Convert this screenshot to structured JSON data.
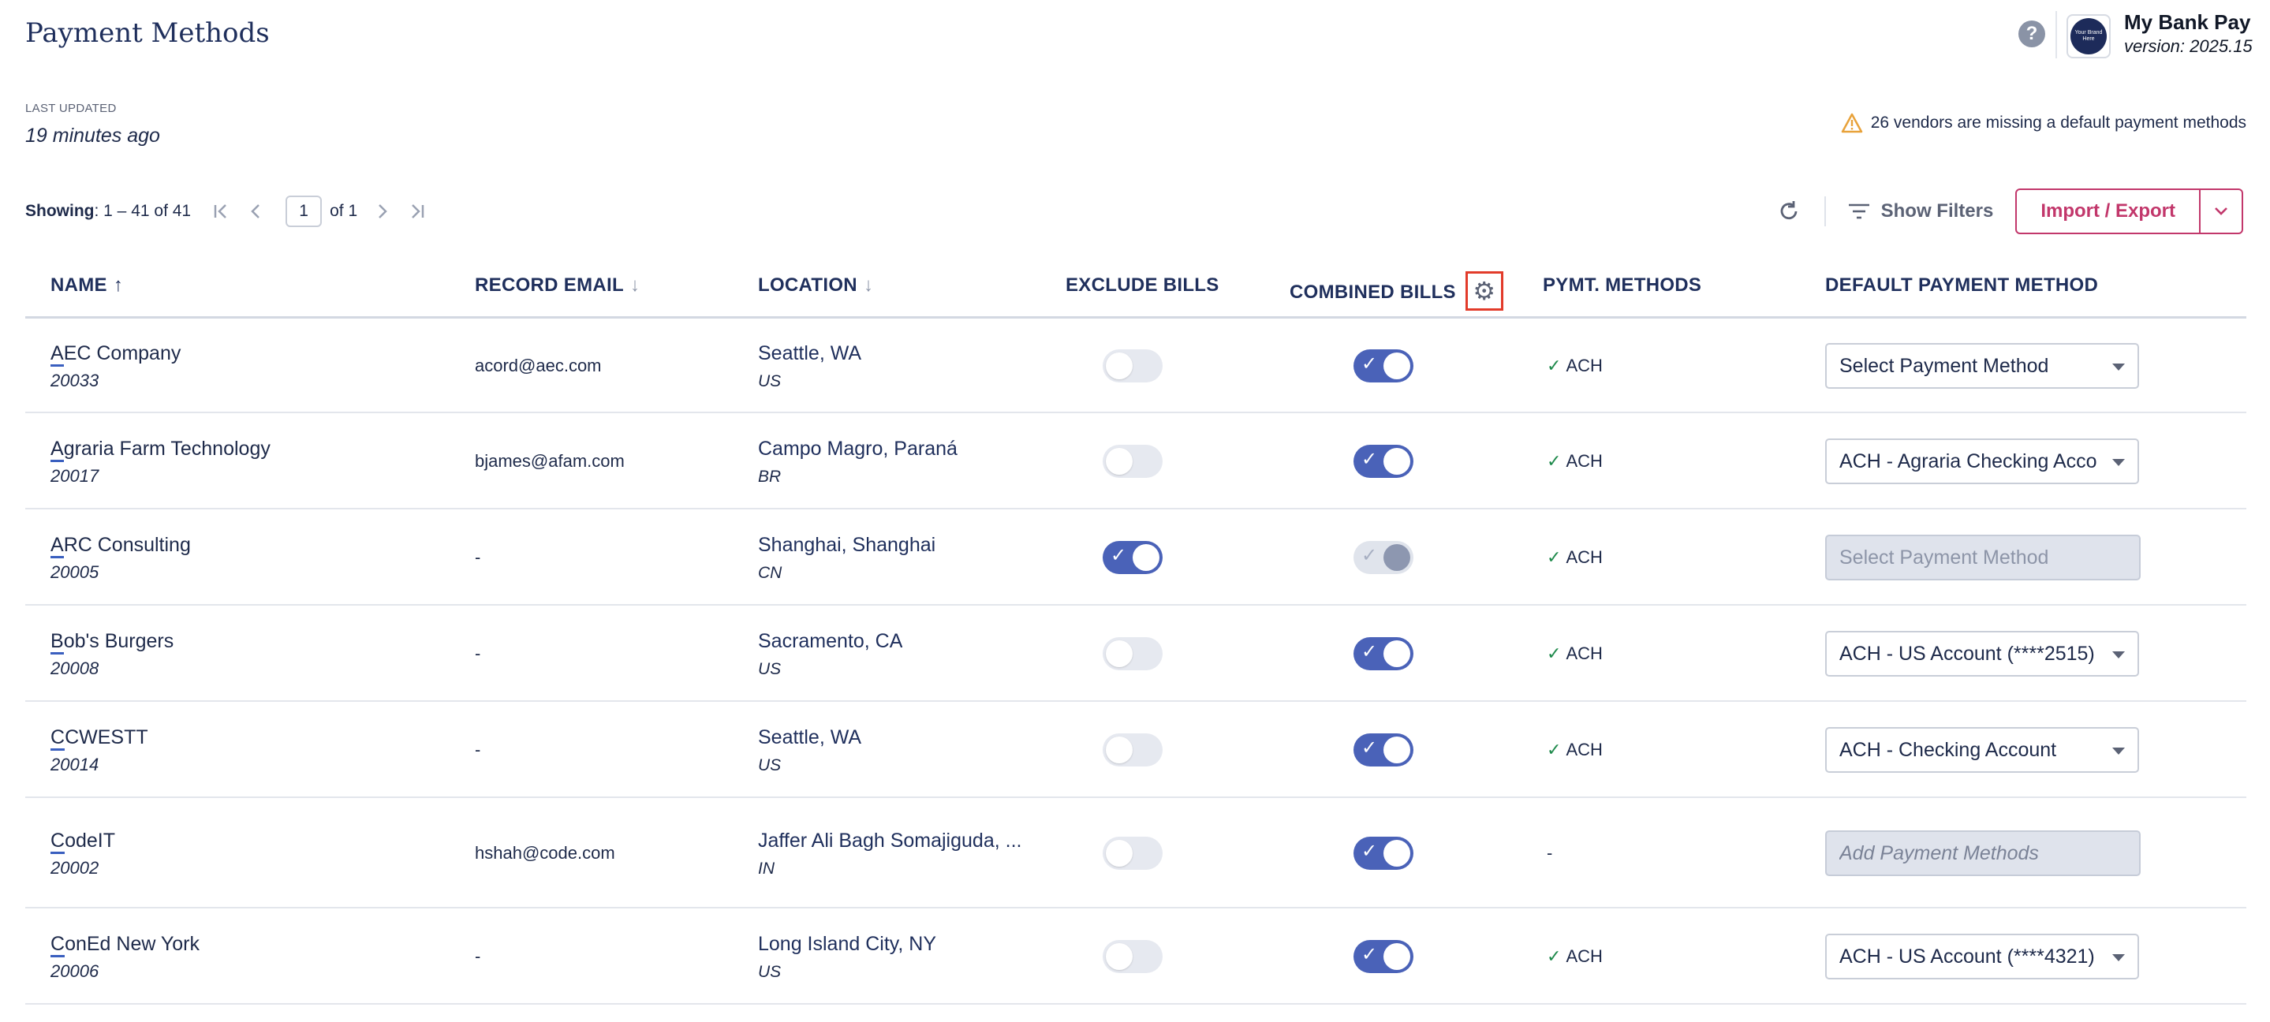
{
  "header": {
    "title": "Payment Methods",
    "help_icon": "?",
    "brand_logo_text": "Your Brand Here",
    "app_name": "My Bank Pay",
    "app_version": "version: 2025.15"
  },
  "status": {
    "last_updated_label": "LAST UPDATED",
    "last_updated_value": "19 minutes ago",
    "warning_text": "26 vendors are missing a default payment methods",
    "warning_color": "#e8a23a"
  },
  "pager": {
    "showing_label": "Showing",
    "showing_value": ": 1 – 41 of 41",
    "page_value": "1",
    "page_of": "of 1"
  },
  "toolbar": {
    "show_filters_label": "Show Filters",
    "import_export_label": "Import / Export",
    "accent_color": "#c2376b"
  },
  "columns": {
    "name": "NAME",
    "record_email": "RECORD EMAIL",
    "location": "LOCATION",
    "exclude_bills": "EXCLUDE BILLS",
    "combined_bills": "COMBINED BILLS",
    "pymt_methods": "PYMT. METHODS",
    "default_payment_method": "DEFAULT PAYMENT METHOD"
  },
  "rows": [
    {
      "name": "AEC Company",
      "id": "20033",
      "email": "acord@aec.com",
      "city": "Seattle, WA",
      "country": "US",
      "exclude": false,
      "combined": "on",
      "pm": "ACH",
      "pm_check": true,
      "default": "Select Payment Method",
      "default_state": "normal"
    },
    {
      "name": "Agraria Farm Technology",
      "id": "20017",
      "email": "bjames@afam.com",
      "city": "Campo Magro, Paraná",
      "country": "BR",
      "exclude": false,
      "combined": "on",
      "pm": "ACH",
      "pm_check": true,
      "default": "ACH - Agraria Checking Acco",
      "default_state": "normal"
    },
    {
      "name": "ARC Consulting",
      "id": "20005",
      "email": "-",
      "city": "Shanghai, Shanghai",
      "country": "CN",
      "exclude": true,
      "combined": "disabled",
      "pm": "ACH",
      "pm_check": true,
      "default": "Select Payment Method",
      "default_state": "disabled"
    },
    {
      "name": "Bob's Burgers",
      "id": "20008",
      "email": "-",
      "city": "Sacramento, CA",
      "country": "US",
      "exclude": false,
      "combined": "on",
      "pm": "ACH",
      "pm_check": true,
      "default": "ACH - US Account (****2515)",
      "default_state": "normal"
    },
    {
      "name": "CCWESTT",
      "id": "20014",
      "email": "-",
      "city": "Seattle, WA",
      "country": "US",
      "exclude": false,
      "combined": "on",
      "pm": "ACH",
      "pm_check": true,
      "default": "ACH - Checking Account",
      "default_state": "normal"
    },
    {
      "name": "CodeIT",
      "id": "20002",
      "email": "hshah@code.com",
      "city": "Jaffer Ali Bagh Somajiguda, ...",
      "country": "IN",
      "exclude": false,
      "combined": "on",
      "pm": "-",
      "pm_check": false,
      "default": "Add Payment Methods",
      "default_state": "placeholder"
    },
    {
      "name": "ConEd New York",
      "id": "20006",
      "email": "-",
      "city": "Long Island City, NY",
      "country": "US",
      "exclude": false,
      "combined": "on",
      "pm": "ACH",
      "pm_check": true,
      "default": "ACH - US Account (****4321)",
      "default_state": "normal"
    }
  ]
}
